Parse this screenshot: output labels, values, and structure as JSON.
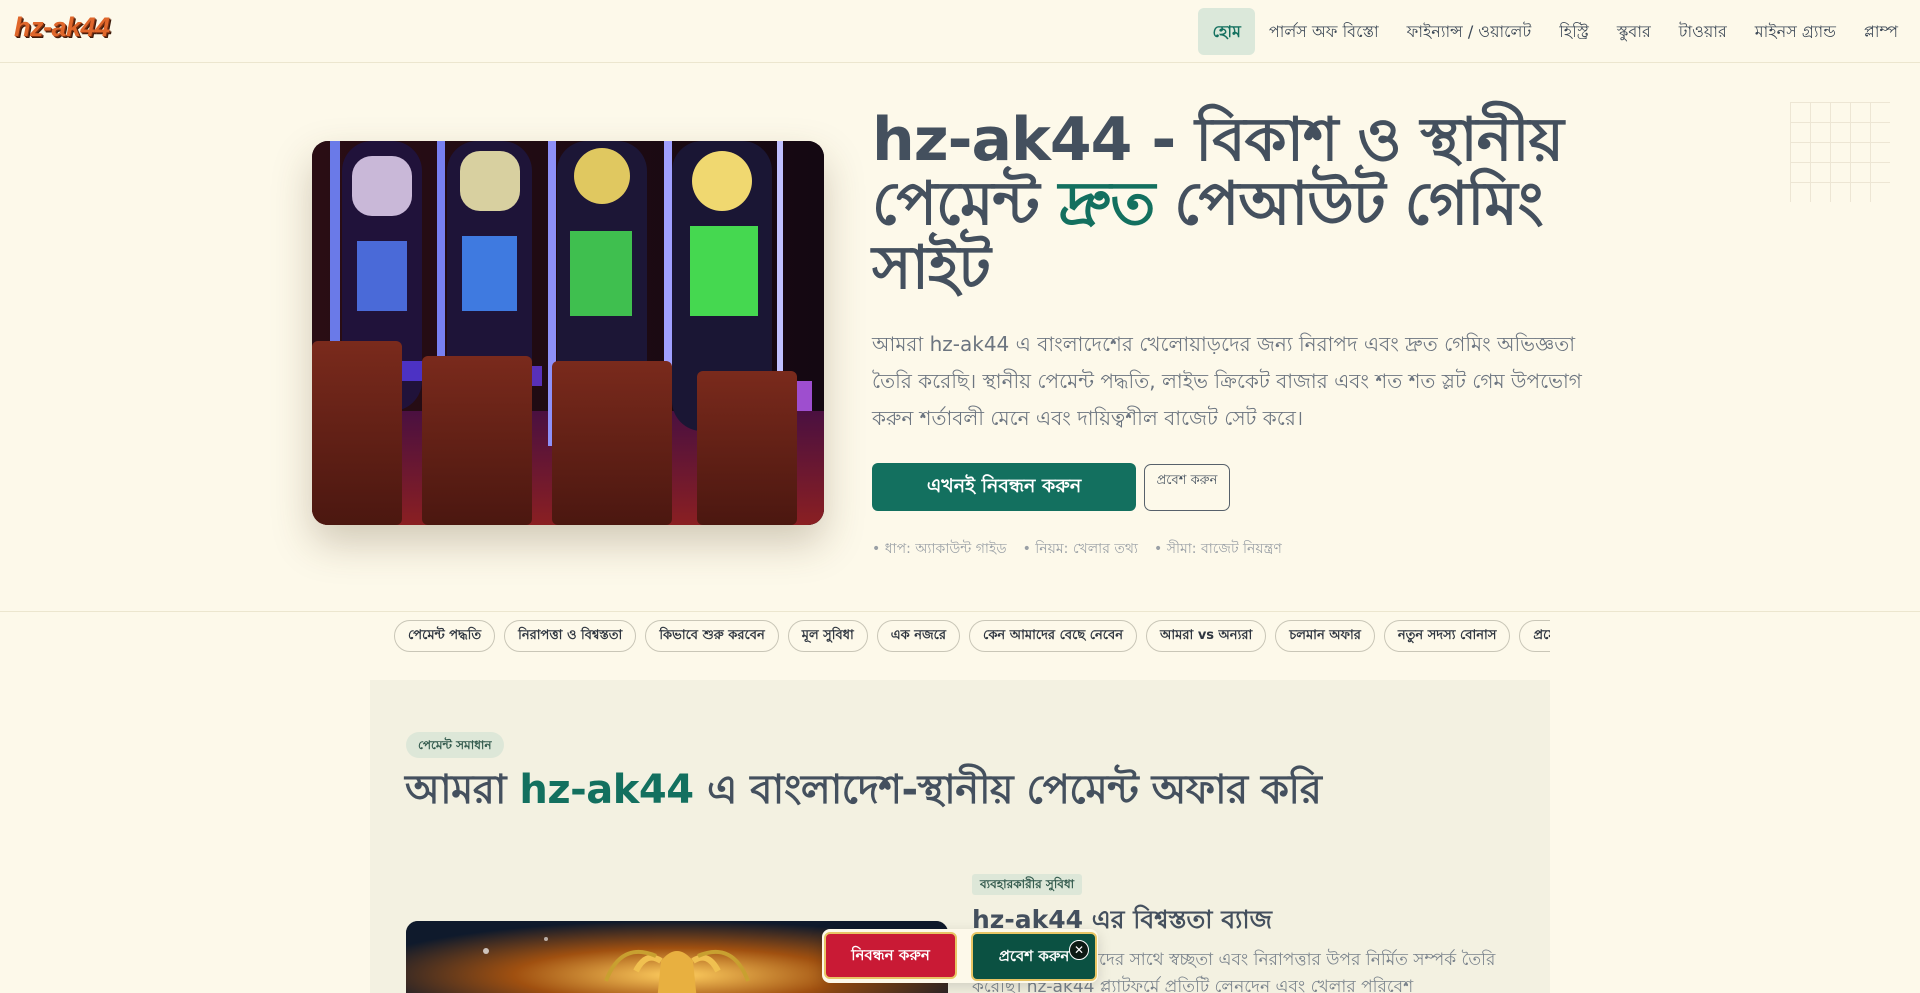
{
  "header": {
    "logo": "hz-ak44",
    "nav": [
      {
        "label": "হোম",
        "active": true
      },
      {
        "label": "পার্লস অফ বিস্তো"
      },
      {
        "label": "ফাইন্যান্স / ওয়ালেট"
      },
      {
        "label": "হিস্ট্রি"
      },
      {
        "label": "স্কুবার"
      },
      {
        "label": "টাওয়ার"
      },
      {
        "label": "মাইনস গ্র্যান্ড"
      },
      {
        "label": "প্লাম্প"
      }
    ]
  },
  "hero": {
    "title_pre": "hz-ak44 - বিকাশ ও স্থানীয় পেমেন্ট ",
    "title_accent": "দ্রুত",
    "title_post": " পেআউট গেমিং সাইট",
    "description": "আমরা hz-ak44 এ বাংলাদেশের খেলোয়াড়দের জন্য নিরাপদ এবং দ্রুত গেমিং অভিজ্ঞতা তৈরি করেছি। স্থানীয় পেমেন্ট পদ্ধতি, লাইভ ক্রিকেট বাজার এবং শত শত স্লট গেম উপভোগ করুন শর্তাবলী মেনে এবং দায়িত্বশীল বাজেট সেট করে।",
    "primary_button": "এখনই নিবন্ধন করুন",
    "secondary_button": "প্রবেশ করুন",
    "meta": [
      "• ধাপ: অ্যাকাউন্ট গাইড",
      "• নিয়ম: খেলার তথ্য",
      "• সীমা: বাজেট নিয়ন্ত্রণ"
    ]
  },
  "chips": [
    "পেমেন্ট পদ্ধতি",
    "নিরাপত্তা ও বিশ্বস্ততা",
    "কিভাবে শুরু করবেন",
    "মূল সুবিধা",
    "এক নজরে",
    "কেন আমাদের বেছে নেবেন",
    "আমরা vs অন্যরা",
    "চলমান অফার",
    "নতুন সদস্য বোনাস",
    "প্রমো"
  ],
  "section": {
    "badge": "পেমেন্ট সমাধান",
    "title_pre": "আমরা ",
    "title_accent": "hz-ak44",
    "title_post": " এ বাংলাদেশ-স্থানীয় পেমেন্ট অফার করি",
    "sub_badge": "ব্যবহারকারীর সুবিধা",
    "sub_title": "hz-ak44 এর বিশ্বস্ততা ব্যাজ",
    "sub_text": "আমরা ব্যবহারকারীদের সাথে স্বচ্ছতা এবং নিরাপত্তার উপর নির্মিত সম্পর্ক তৈরি করেছি। hz-ak44 প্ল্যাটফর্মে প্রতিটি লেনদেন এবং খেলার পরিবেশ"
  },
  "floating": {
    "register": "নিবন্ধন করুন",
    "login": "প্রবেশ করুন",
    "close": "✕"
  }
}
